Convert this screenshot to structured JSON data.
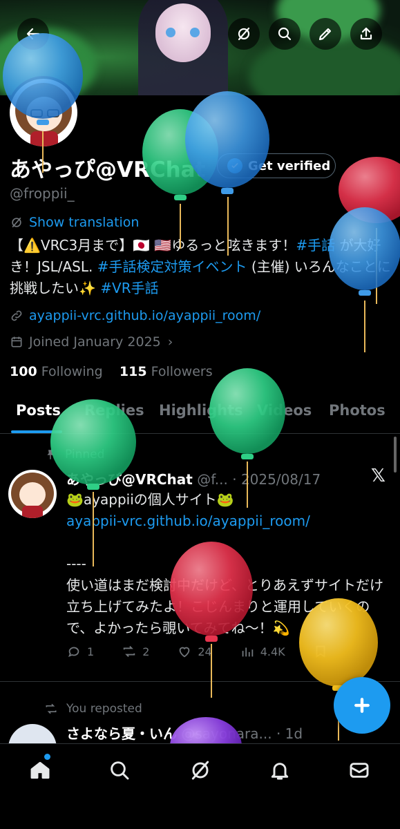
{
  "profile": {
    "name": "あやっぴ@VRChat",
    "handle": "@froppii_",
    "verify_label": "Get verified",
    "show_translation": "Show translation",
    "bio_parts": {
      "p1": "【⚠️VRC3月まで】🇯🇵 🇺🇸ゆるっと呟きます！",
      "t1": "#手話",
      "p2": " が大好き！JSL/ASL. ",
      "t2": "#手話検定対策イベント",
      "p3": " (主催) いろんなことに挑戦したい✨ ",
      "t3": "#VR手話"
    },
    "link": "ayappii-vrc.github.io/ayappii_room/",
    "joined": "Joined January 2025",
    "following_count": "100",
    "following_label": "Following",
    "followers_count": "115",
    "followers_label": "Followers"
  },
  "tabs": [
    "Posts",
    "Replies",
    "Highlights",
    "Videos",
    "Photos"
  ],
  "post1": {
    "pinned_label": "Pinned",
    "name": "あやっぴ@VRChat",
    "meta": " @f... · 2025/08/17",
    "line1": "🐸ayappiiの個人サイト🐸",
    "link": "ayappii-vrc.github.io/ayappii_room/",
    "line3": "----",
    "body": "使い道はまだ検討中だけど、とりあえずサイトだけ立ち上げてみたよ！こじんまりと運用していくので、よかったら覗いてみてね〜！💫",
    "replies": "1",
    "reposts": "2",
    "likes": "24",
    "views": "4.4K"
  },
  "post2": {
    "reposted_label": "You reposted",
    "name": "さよなら夏・いん",
    "meta": " @sayonara... · 1d"
  },
  "colors": {
    "accent": "#1d9bf0",
    "background": "#000000",
    "muted": "#71767b"
  }
}
